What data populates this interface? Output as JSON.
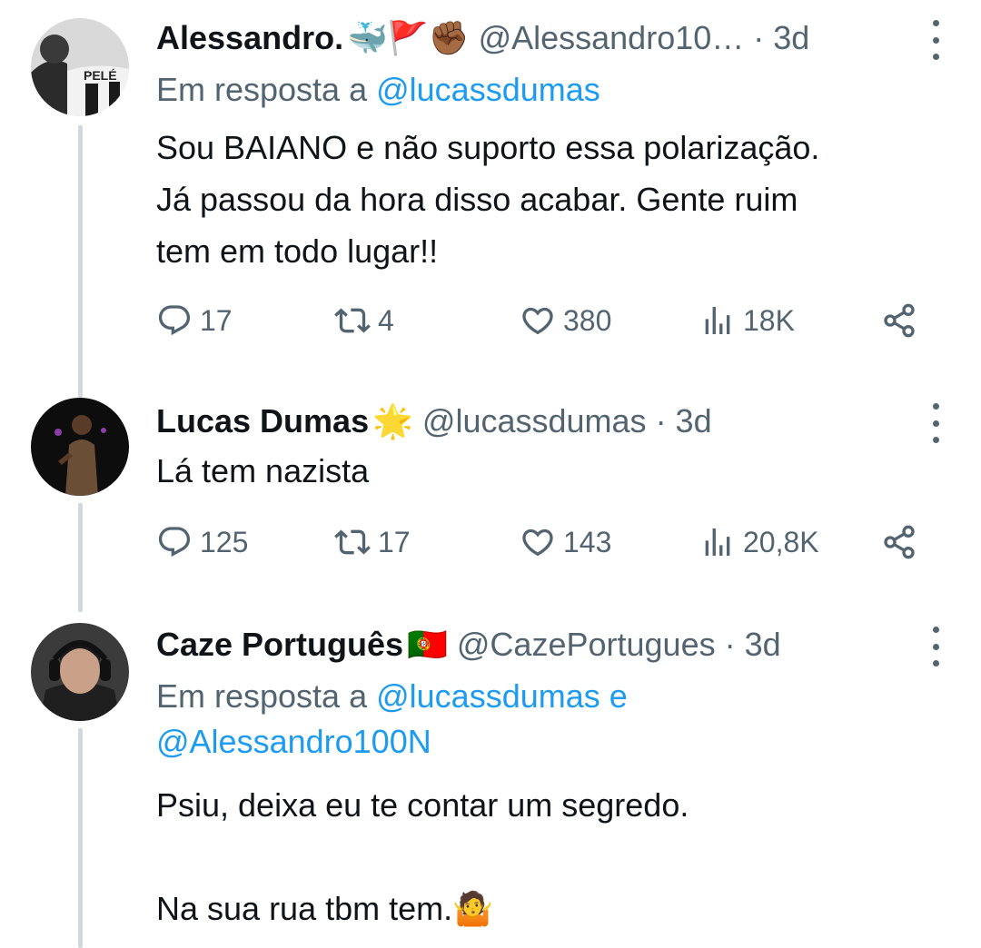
{
  "tweets": [
    {
      "name": "Alessandro.",
      "name_emoji": "🐳🚩✊🏾",
      "handle": "@Alessandro10…",
      "time": "· 3d",
      "reply_prefix": "Em resposta a ",
      "reply_users": "@lucassdumas",
      "body": "Sou BAIANO e não suporto essa polarização.\nJá passou da hora disso acabar. Gente ruim\ntem em todo lugar!!",
      "avatar_text": "PELÉ",
      "stats": {
        "replies": "17",
        "retweets": "4",
        "likes": "380",
        "views": "18K"
      }
    },
    {
      "name": "Lucas Dumas",
      "name_emoji": "🌟",
      "handle": "@lucassdumas",
      "time": "· 3d",
      "body": "Lá tem nazista",
      "stats": {
        "replies": "125",
        "retweets": "17",
        "likes": "143",
        "views": "20,8K"
      }
    },
    {
      "name": "Caze Português",
      "name_emoji": "🇵🇹",
      "handle": "@CazePortugues",
      "time": "· 3d",
      "reply_prefix": "Em resposta a ",
      "reply_users": "@lucassdumas e\n@Alessandro100N",
      "body": "Psiu, deixa eu te contar um segredo.\n\nNa sua rua tbm tem.🤷"
    }
  ],
  "icons": {
    "reply": "reply-icon",
    "retweet": "retweet-icon",
    "like": "heart-icon",
    "views": "views-icon",
    "share": "share-icon",
    "more": "more-icon"
  },
  "colors": {
    "text": "#0f1419",
    "secondary": "#536471",
    "link": "#1d9bf0",
    "thread_line": "#cfd9de"
  }
}
